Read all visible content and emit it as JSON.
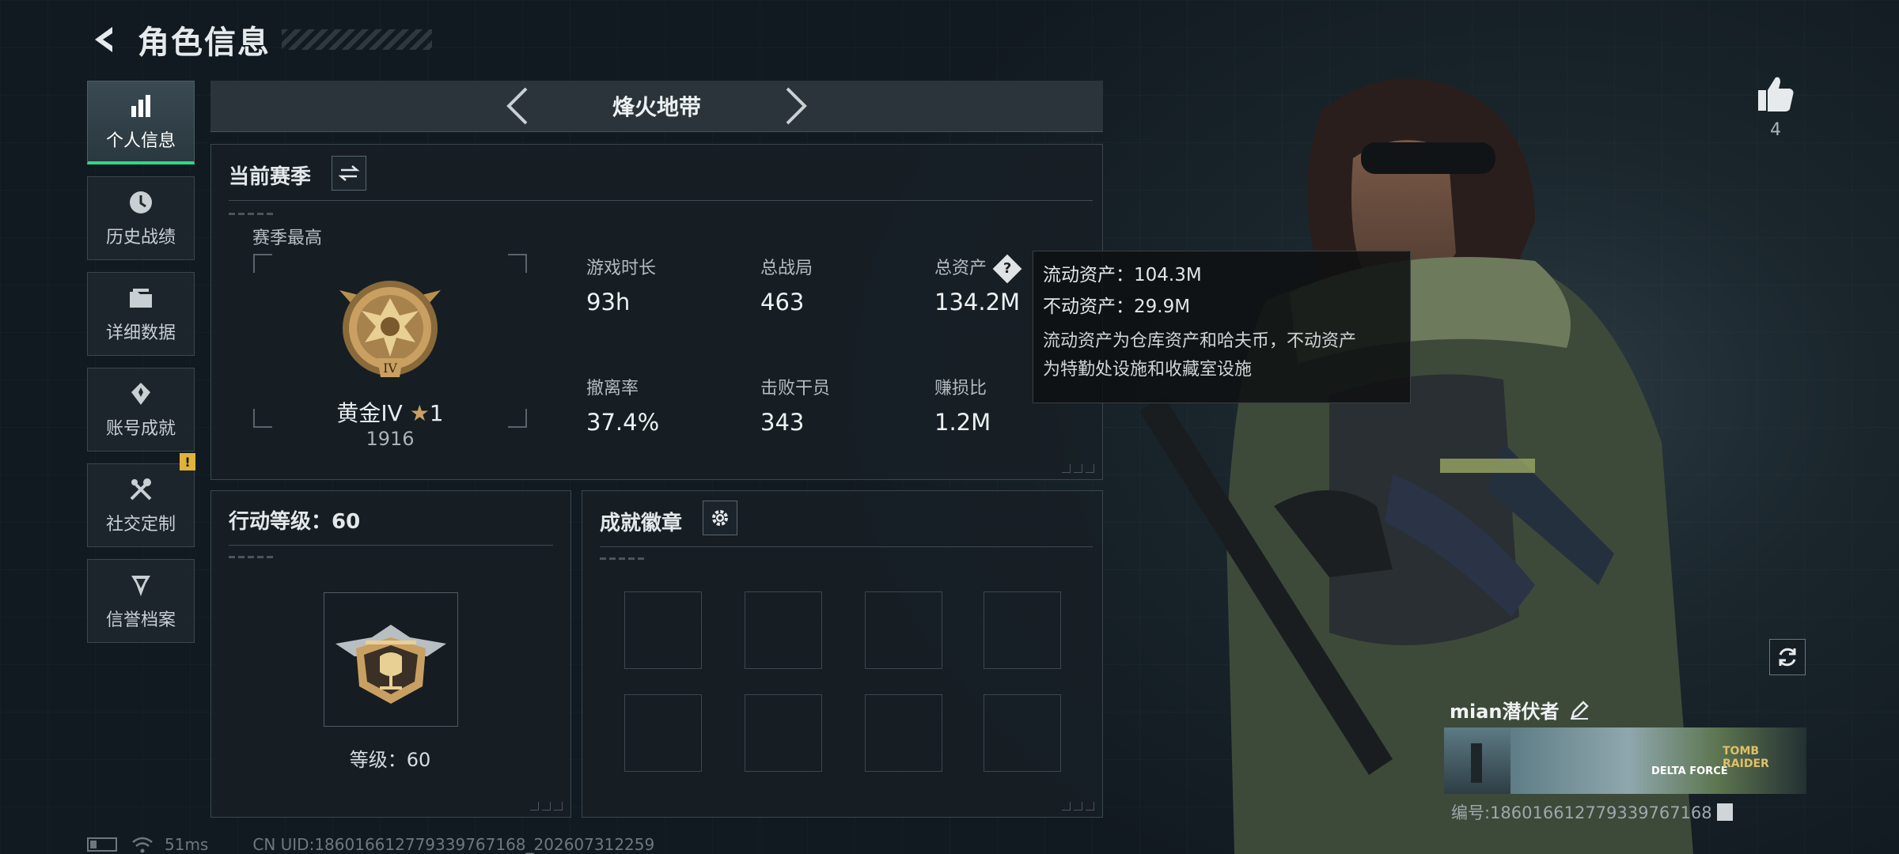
{
  "header": {
    "title": "角色信息"
  },
  "nav": {
    "items": [
      {
        "label": "个人信息",
        "icon": "bar-chart-icon",
        "active": true
      },
      {
        "label": "历史战绩",
        "icon": "clock-icon"
      },
      {
        "label": "详细数据",
        "icon": "folder-icon"
      },
      {
        "label": "账号成就",
        "icon": "achievement-icon"
      },
      {
        "label": "社交定制",
        "icon": "tools-icon",
        "badge": "!"
      },
      {
        "label": "信誉档案",
        "icon": "credit-shield-icon"
      }
    ]
  },
  "mode": {
    "name": "烽火地带"
  },
  "season": {
    "title": "当前赛季",
    "subtitle": "赛季最高",
    "rank_name": "黄金IV",
    "rank_stars": "1",
    "rank_score": "1916",
    "rank_roman": "IV",
    "stats": [
      {
        "label": "游戏时长",
        "value": "93h"
      },
      {
        "label": "总战局",
        "value": "463"
      },
      {
        "label": "总资产",
        "value": "134.2M",
        "help": "?"
      },
      {
        "label": "撤离率",
        "value": "37.4%"
      },
      {
        "label": "击败干员",
        "value": "343"
      },
      {
        "label": "赚损比",
        "value": "1.2M"
      }
    ]
  },
  "tooltip": {
    "liquid": "流动资产：104.3M",
    "fixed": "不动资产：29.9M",
    "desc_1": "流动资产为仓库资产和哈夫币，不动资产",
    "desc_2": "为特勤处设施和收藏室设施"
  },
  "level": {
    "title": "行动等级：60",
    "text": "等级：60"
  },
  "badges": {
    "title": "成就徽章",
    "slots": 8
  },
  "profile": {
    "likes": "4",
    "name": "mian潜伏者",
    "banner_brand_1": "DELTA FORCE",
    "banner_brand_2": "TOMB RAIDER",
    "id": "编号:186016612779339767168"
  },
  "status": {
    "ping": "51ms",
    "uid": "CN UID:186016612779339767168_202607312259"
  },
  "colors": {
    "accent": "#31d68a",
    "badge": "#e0b23a",
    "gold": "#c9a062"
  }
}
